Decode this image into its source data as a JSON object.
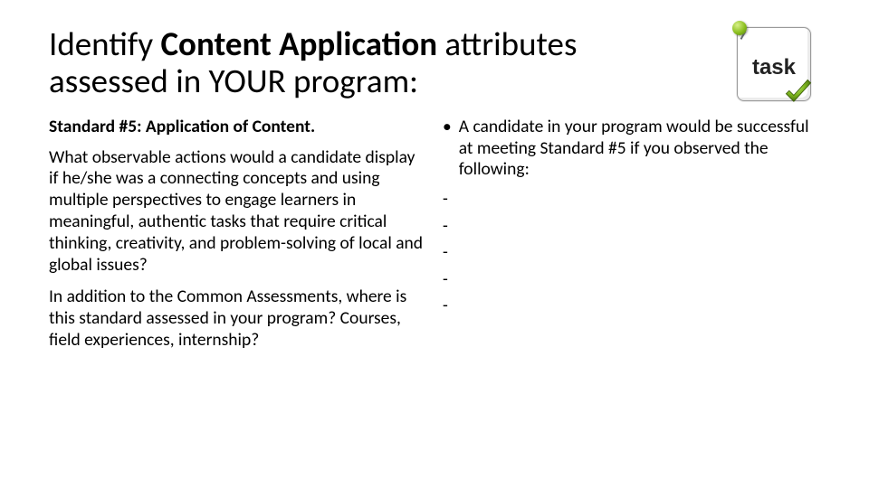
{
  "title": {
    "pre": "Identify ",
    "bold": "Content Application",
    "post": " attributes assessed in YOUR program:"
  },
  "task_badge": {
    "label": "task"
  },
  "left_column": {
    "standard_heading": "Standard #5: Application of Content.",
    "para1": "What observable actions would a candidate display if he/she was a connecting concepts and using multiple perspectives to engage learners in meaningful, authentic tasks that require critical thinking, creativity, and problem-solving of local and global issues?",
    "para2": "In addition to the Common Assessments, where is this standard assessed in your program? Courses, field experiences, internship?"
  },
  "right_column": {
    "bullet_marker": "•",
    "bullet_text": "A candidate in your program would be successful at meeting Standard #5 if you observed the following:",
    "dashes": [
      "-",
      "-",
      "-",
      "-",
      "-"
    ]
  }
}
